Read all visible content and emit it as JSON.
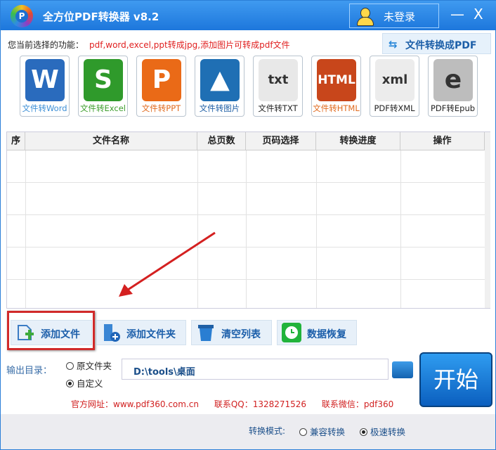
{
  "title": "全方位PDF转换器 v8.2",
  "logo_letter": "P",
  "login": "未登录",
  "window": {
    "minimize": "—",
    "close": "X"
  },
  "function_label": "您当前选择的功能：",
  "function_value": "pdf,word,excel,ppt转成jpg,添加图片可转成pdf文件",
  "to_pdf_button": "文件转换成PDF",
  "tools": [
    {
      "label": "文件转Word",
      "glyph": "W",
      "color": "#2a6bbd",
      "label_color": "#3d8fd6"
    },
    {
      "label": "文件转Excel",
      "glyph": "S",
      "color": "#2f9a2b",
      "label_color": "#3c9e2c"
    },
    {
      "label": "文件转PPT",
      "glyph": "P",
      "color": "#ea6a17",
      "label_color": "#e06a1e"
    },
    {
      "label": "文件转图片",
      "glyph": "▲",
      "color": "#1f6fb4",
      "label_color": "#1f5fa5"
    },
    {
      "label": "文件转TXT",
      "glyph": "txt",
      "color": "#e8e8e8",
      "label_color": "#222"
    },
    {
      "label": "文件转HTML",
      "glyph": "HTML",
      "color": "#c8461b",
      "label_color": "#e06a1e"
    },
    {
      "label": "PDF转XML",
      "glyph": "xml",
      "color": "#ececec",
      "label_color": "#222"
    },
    {
      "label": "PDF转Epub",
      "glyph": "e",
      "color": "#bdbdbd",
      "label_color": "#222"
    }
  ],
  "table": {
    "headers": [
      "序",
      "文件名称",
      "总页数",
      "页码选择",
      "转换进度",
      "操作"
    ],
    "rows": []
  },
  "buttons": {
    "add_file": "添加文件",
    "add_folder": "添加文件夹",
    "clear_list": "清空列表",
    "restore": "数据恢复"
  },
  "output": {
    "label": "输出目录：",
    "option_source": "原文件夹",
    "option_custom": "自定义",
    "selected": "自定义",
    "path": "D:\\tools\\桌面"
  },
  "start": "开始",
  "links": {
    "site": "官方网址：www.pdf360.com.cn",
    "qq": "联系QQ：1328271526",
    "wechat": "联系微信：pdf360"
  },
  "mode": {
    "label": "转换模式:",
    "compatible": "兼容转换",
    "fast": "极速转换",
    "selected": "极速转换"
  }
}
